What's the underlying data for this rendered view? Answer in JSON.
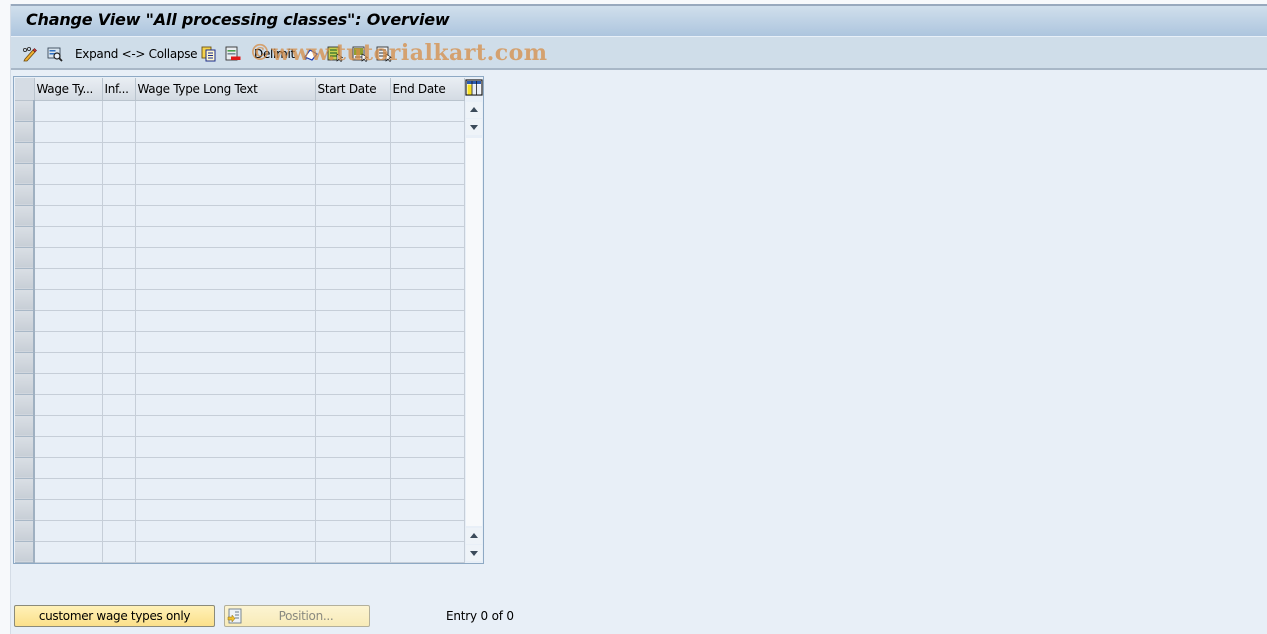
{
  "window": {
    "title": "Change View \"All processing classes\": Overview"
  },
  "toolbar": {
    "items": [
      {
        "icon": "display-change-icon",
        "label": ""
      },
      {
        "icon": "find-icon",
        "label": ""
      },
      {
        "icon": "",
        "label": "Expand <-> Collapse"
      },
      {
        "icon": "copy-as-icon",
        "label": ""
      },
      {
        "icon": "delete-icon",
        "label": ""
      },
      {
        "icon": "",
        "label": "Delimit"
      },
      {
        "icon": "undo-change-icon",
        "label": ""
      },
      {
        "icon": "select-all-icon",
        "label": ""
      },
      {
        "icon": "select-block-icon",
        "label": ""
      },
      {
        "icon": "deselect-all-icon",
        "label": ""
      }
    ],
    "expand_collapse_label": "Expand <-> Collapse",
    "delimit_label": "Delimit"
  },
  "watermark": "©www.tutorialkart.com",
  "table": {
    "columns": [
      {
        "label": "Wage Ty..."
      },
      {
        "label": "Inf..."
      },
      {
        "label": "Wage Type Long Text"
      },
      {
        "label": "Start Date"
      },
      {
        "label": "End Date"
      }
    ],
    "rows": [
      [
        "",
        "",
        "",
        "",
        ""
      ],
      [
        "",
        "",
        "",
        "",
        ""
      ],
      [
        "",
        "",
        "",
        "",
        ""
      ],
      [
        "",
        "",
        "",
        "",
        ""
      ],
      [
        "",
        "",
        "",
        "",
        ""
      ],
      [
        "",
        "",
        "",
        "",
        ""
      ],
      [
        "",
        "",
        "",
        "",
        ""
      ],
      [
        "",
        "",
        "",
        "",
        ""
      ],
      [
        "",
        "",
        "",
        "",
        ""
      ],
      [
        "",
        "",
        "",
        "",
        ""
      ],
      [
        "",
        "",
        "",
        "",
        ""
      ],
      [
        "",
        "",
        "",
        "",
        ""
      ],
      [
        "",
        "",
        "",
        "",
        ""
      ],
      [
        "",
        "",
        "",
        "",
        ""
      ],
      [
        "",
        "",
        "",
        "",
        ""
      ],
      [
        "",
        "",
        "",
        "",
        ""
      ],
      [
        "",
        "",
        "",
        "",
        ""
      ],
      [
        "",
        "",
        "",
        "",
        ""
      ],
      [
        "",
        "",
        "",
        "",
        ""
      ],
      [
        "",
        "",
        "",
        "",
        ""
      ],
      [
        "",
        "",
        "",
        "",
        ""
      ],
      [
        "",
        "",
        "",
        "",
        ""
      ]
    ]
  },
  "footer": {
    "customer_button_label": "customer wage types only",
    "position_button_label": "Position...",
    "entry_info": "Entry 0 of 0"
  }
}
